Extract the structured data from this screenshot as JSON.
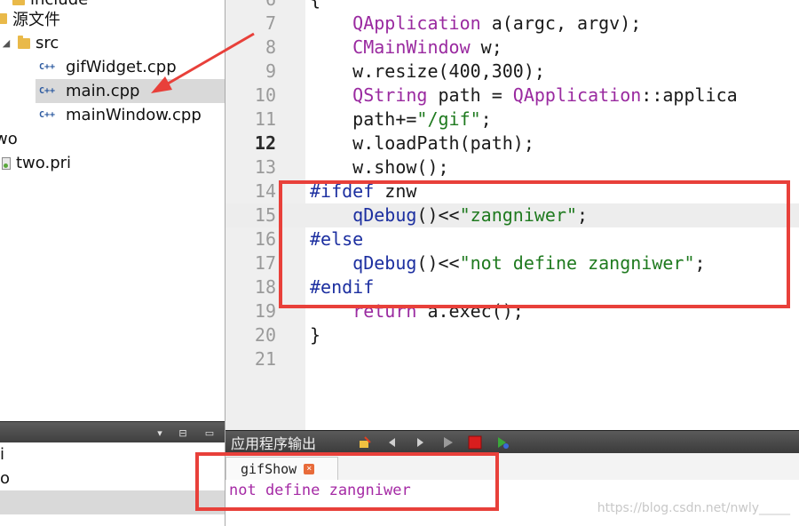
{
  "project_tree": {
    "partial_top_label": "include",
    "items": [
      {
        "label": "源文件",
        "type": "folder"
      },
      {
        "label": "src",
        "type": "folder"
      },
      {
        "label": "gifWidget.cpp",
        "type": "cpp"
      },
      {
        "label": "main.cpp",
        "type": "cpp",
        "selected": true
      },
      {
        "label": "mainWindow.cpp",
        "type": "cpp"
      },
      {
        "label": "wo",
        "type": "text"
      },
      {
        "label": "two.pri",
        "type": "pri"
      }
    ]
  },
  "left_bottom": {
    "rows": [
      {
        "label": "i"
      },
      {
        "label": "o"
      },
      {
        "label": "",
        "selected": true
      }
    ]
  },
  "editor": {
    "current_line": "12",
    "lines": [
      {
        "num": "6",
        "segments": [
          {
            "t": "{",
            "c": "plain"
          }
        ]
      },
      {
        "num": "7",
        "segments": [
          {
            "t": "    ",
            "c": "plain"
          },
          {
            "t": "QApplication",
            "c": "type"
          },
          {
            "t": " a(argc, argv);",
            "c": "plain"
          }
        ]
      },
      {
        "num": "8",
        "segments": [
          {
            "t": "    ",
            "c": "plain"
          },
          {
            "t": "CMainWindow",
            "c": "type"
          },
          {
            "t": " w;",
            "c": "plain"
          }
        ]
      },
      {
        "num": "9",
        "segments": [
          {
            "t": "    w.resize(400,300);",
            "c": "plain"
          }
        ]
      },
      {
        "num": "10",
        "segments": [
          {
            "t": "    ",
            "c": "plain"
          },
          {
            "t": "QString",
            "c": "type"
          },
          {
            "t": " path = ",
            "c": "plain"
          },
          {
            "t": "QApplication",
            "c": "type"
          },
          {
            "t": "::applica",
            "c": "plain"
          }
        ]
      },
      {
        "num": "11",
        "segments": [
          {
            "t": "    path+=",
            "c": "plain"
          },
          {
            "t": "\"/gif\"",
            "c": "str"
          },
          {
            "t": ";",
            "c": "plain"
          }
        ]
      },
      {
        "num": "12",
        "segments": [
          {
            "t": "    w.loadPath(path);",
            "c": "plain"
          }
        ]
      },
      {
        "num": "13",
        "segments": [
          {
            "t": "    w.show();",
            "c": "plain"
          }
        ]
      },
      {
        "num": "14",
        "segments": [
          {
            "t": "#ifdef",
            "c": "pre"
          },
          {
            "t": " znw",
            "c": "plain"
          }
        ]
      },
      {
        "num": "15",
        "segments": [
          {
            "t": "    ",
            "c": "plain"
          },
          {
            "t": "qDebug",
            "c": "fn"
          },
          {
            "t": "()<<",
            "c": "plain"
          },
          {
            "t": "\"zangniwer\"",
            "c": "str"
          },
          {
            "t": ";",
            "c": "plain"
          }
        ]
      },
      {
        "num": "16",
        "segments": [
          {
            "t": "#else",
            "c": "pre"
          }
        ]
      },
      {
        "num": "17",
        "segments": [
          {
            "t": "    ",
            "c": "plain"
          },
          {
            "t": "qDebug",
            "c": "fn"
          },
          {
            "t": "()<<",
            "c": "plain"
          },
          {
            "t": "\"not define zangniwer\"",
            "c": "str"
          },
          {
            "t": ";",
            "c": "plain"
          }
        ]
      },
      {
        "num": "18",
        "segments": [
          {
            "t": "#endif",
            "c": "pre"
          }
        ]
      },
      {
        "num": "19",
        "segments": [
          {
            "t": "    ",
            "c": "plain"
          },
          {
            "t": "return",
            "c": "type"
          },
          {
            "t": " a.exec();",
            "c": "plain"
          }
        ]
      },
      {
        "num": "20",
        "segments": [
          {
            "t": "}",
            "c": "plain"
          }
        ]
      },
      {
        "num": "21",
        "segments": [
          {
            "t": "",
            "c": "plain"
          }
        ]
      }
    ]
  },
  "output": {
    "title": "应用程序输出",
    "tab_label": "gifShow",
    "text": "not define zangniwer"
  },
  "watermark": "https://blog.csdn.net/nwly_____",
  "colors": {
    "annotation_red": "#e8403a",
    "type_purple": "#9a2aa0",
    "string_green": "#1f7a1f",
    "preproc_blue": "#1c2fa0",
    "output_magenta": "#a52aa5"
  }
}
